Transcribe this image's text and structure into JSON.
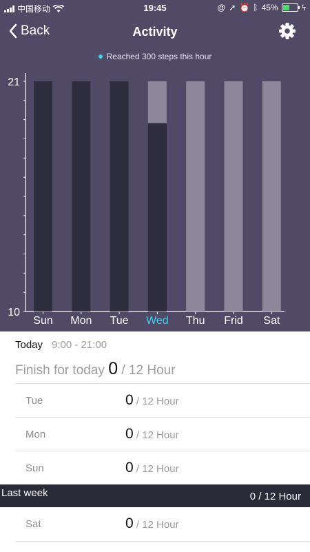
{
  "status_bar": {
    "carrier": "中国移动",
    "time": "19:45",
    "battery_percent": "45%",
    "battery_level": 0.45
  },
  "nav": {
    "back_label": "Back",
    "title": "Activity"
  },
  "legend": {
    "text": "Reached 300 steps this hour",
    "dot_color": "#3fd0f0"
  },
  "chart_data": {
    "type": "bar",
    "categories": [
      "Sun",
      "Mon",
      "Tue",
      "Wed",
      "Thu",
      "Frid",
      "Sat"
    ],
    "highlight_category": "Wed",
    "y_ticks": [
      "21",
      "10"
    ],
    "ylim": [
      10,
      21
    ],
    "series": [
      {
        "values": [
          21,
          21,
          21,
          19,
          10,
          10,
          10
        ],
        "color": "#2e2d3d"
      },
      {
        "values": [
          0,
          0,
          0,
          2,
          11,
          11,
          11
        ],
        "color": "#8c8899"
      }
    ],
    "grid": false
  },
  "today": {
    "label": "Today",
    "time_range": "9:00 - 21:00",
    "finish_label": "Finish for today",
    "value": "0",
    "unit": "/ 12 Hour"
  },
  "days": [
    {
      "name": "Tue",
      "value": "0",
      "unit": "/ 12 Hour"
    },
    {
      "name": "Mon",
      "value": "0",
      "unit": "/ 12 Hour"
    },
    {
      "name": "Sun",
      "value": "0",
      "unit": "/ 12 Hour"
    }
  ],
  "last_week": {
    "label": "Last week",
    "summary": "0 / 12 Hour"
  },
  "last_week_days": [
    {
      "name": "Sat",
      "value": "0",
      "unit": "/ 12 Hour"
    }
  ]
}
